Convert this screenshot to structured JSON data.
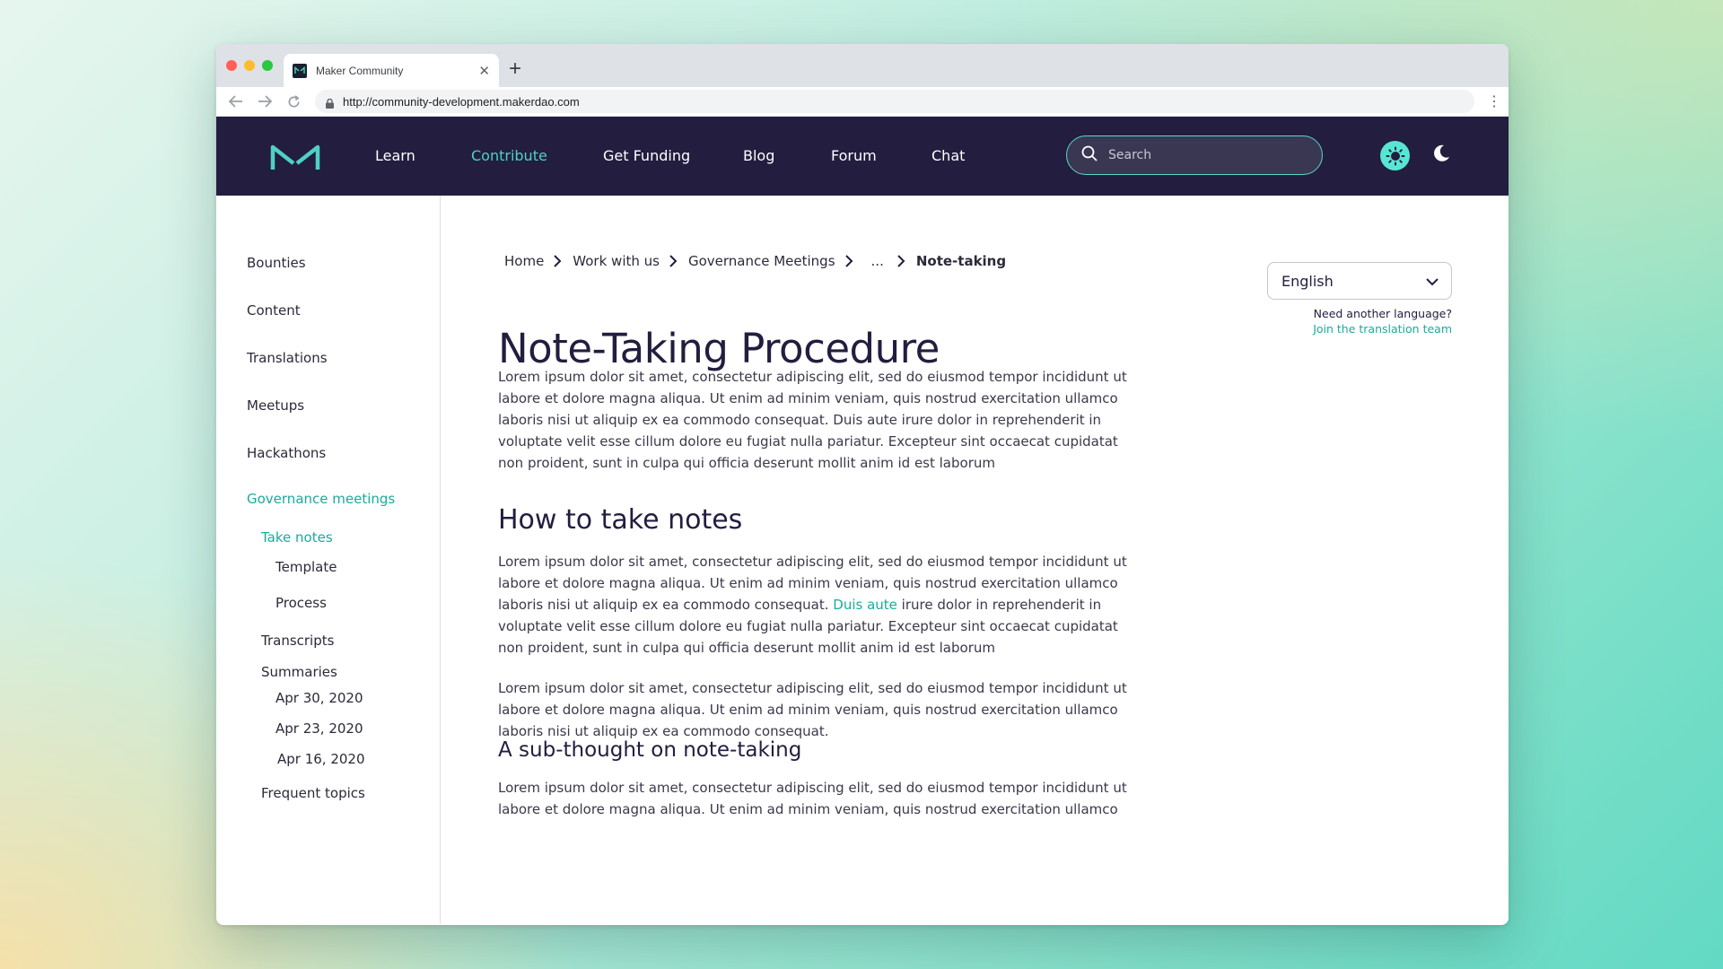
{
  "browser": {
    "tab_title": "Maker Community",
    "url": "http://community-development.makerdao.com"
  },
  "header": {
    "nav": [
      "Learn",
      "Contribute",
      "Get Funding",
      "Blog",
      "Forum",
      "Chat"
    ],
    "active_nav": "Contribute",
    "search_placeholder": "Search"
  },
  "sidebar": {
    "items": {
      "bounties": "Bounties",
      "content": "Content",
      "translations": "Translations",
      "meetups": "Meetups",
      "hackathons": "Hackathons",
      "governance": "Governance meetings",
      "take_notes": "Take notes",
      "template": "Template",
      "process": "Process",
      "transcripts": "Transcripts",
      "summaries": "Summaries",
      "apr30": "Apr 30, 2020",
      "apr23": "Apr 23, 2020",
      "apr16": "Apr 16, 2020",
      "frequent": "Frequent topics"
    }
  },
  "breadcrumb": {
    "home": "Home",
    "work": "Work with us",
    "governance": "Governance Meetings",
    "ellipsis": "...",
    "current": "Note-taking"
  },
  "main": {
    "title": "Note-Taking Procedure",
    "intro": "Lorem ipsum dolor sit amet, consectetur adipiscing elit, sed do eiusmod tempor incididunt ut labore et dolore magna aliqua. Ut enim ad minim veniam, quis nostrud exercitation ullamco laboris nisi ut aliquip ex ea commodo consequat. Duis aute irure dolor in reprehenderit in voluptate velit esse cillum dolore eu fugiat nulla pariatur. Excepteur sint occaecat cupidatat non proident, sunt in culpa qui officia deserunt mollit anim id est laborum",
    "h2": "How to take notes",
    "p2_before": "Lorem ipsum dolor sit amet, consectetur adipiscing elit, sed do eiusmod tempor incididunt ut labore et dolore magna aliqua. Ut enim ad minim veniam, quis nostrud exercitation ullamco laboris nisi ut aliquip ex ea commodo consequat. ",
    "p2_link": "Duis aute",
    "p2_after": " irure dolor in reprehenderit in voluptate velit esse cillum dolore eu fugiat nulla pariatur. Excepteur sint occaecat cupidatat non proident, sunt in culpa qui officia deserunt mollit anim id est laborum",
    "p3": "Lorem ipsum dolor sit amet, consectetur adipiscing elit, sed do eiusmod tempor incididunt ut labore et dolore magna aliqua. Ut enim ad minim veniam, quis nostrud exercitation ullamco laboris nisi ut aliquip ex ea commodo consequat.",
    "h3": "A sub-thought on note-taking",
    "p4": "Lorem ipsum dolor sit amet, consectetur adipiscing elit, sed do eiusmod tempor incididunt ut labore et dolore magna aliqua. Ut enim ad minim veniam, quis nostrud exercitation ullamco"
  },
  "language": {
    "selected": "English",
    "help_question": "Need another language?",
    "help_link": "Join the translation team"
  },
  "colors": {
    "header_bg": "#231d3f",
    "accent": "#1aab9b",
    "accent_light": "#4fd1c5"
  }
}
